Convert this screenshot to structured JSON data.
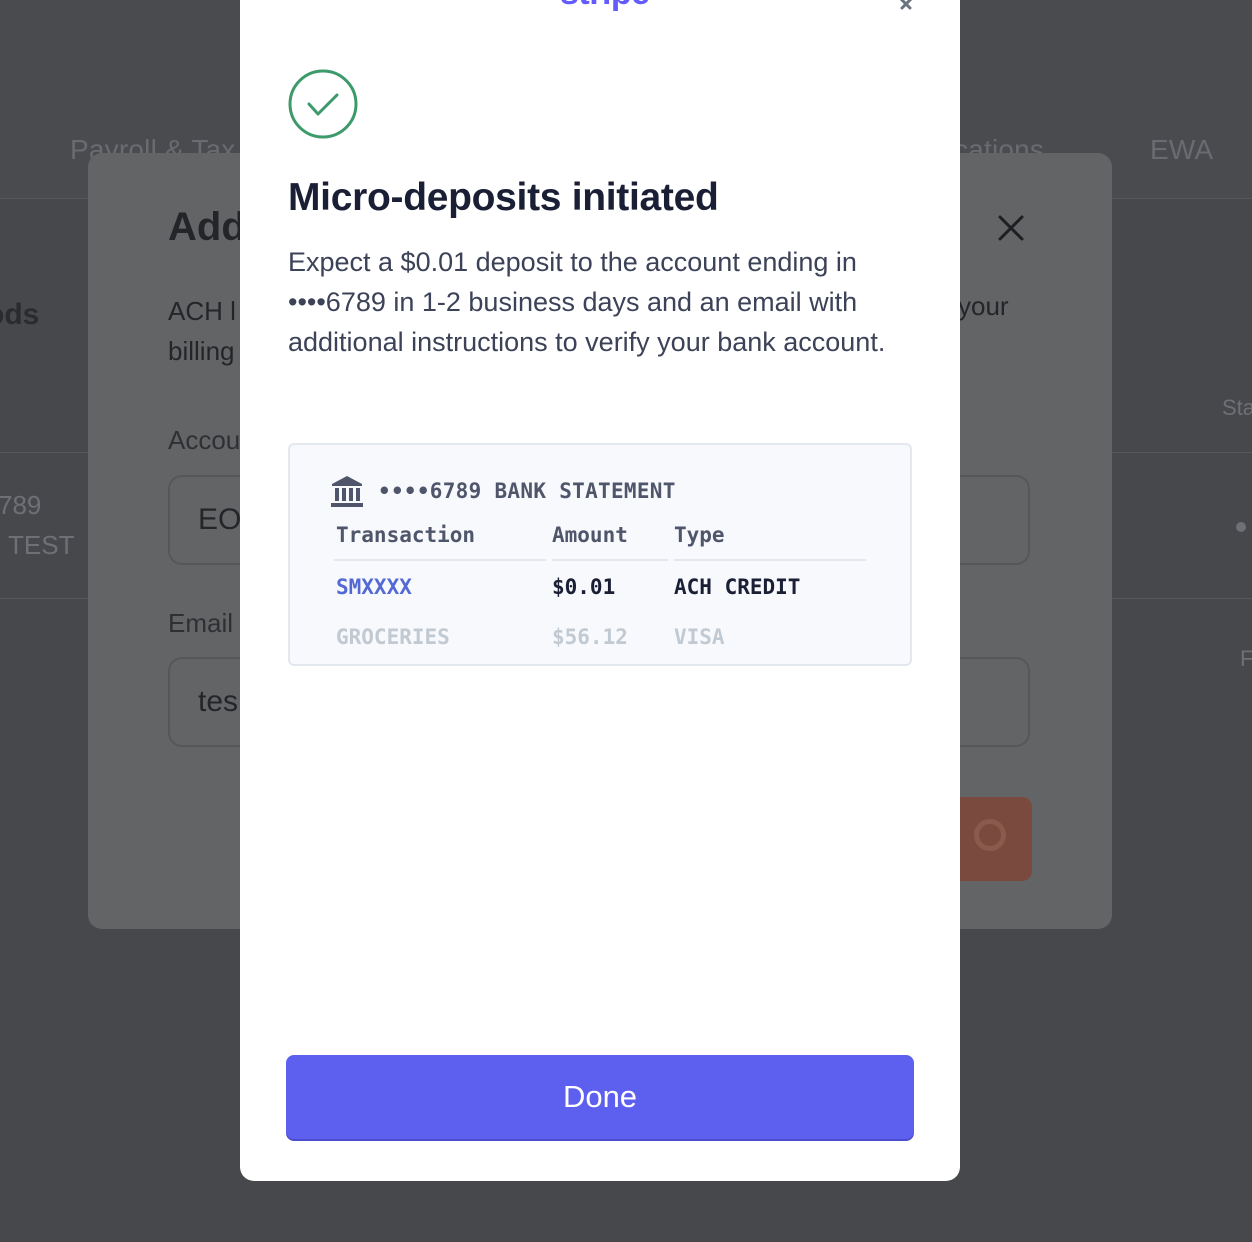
{
  "background": {
    "nav_tabs": [
      "Payroll & Tax",
      "cations",
      "EWA"
    ],
    "section_title": "ods",
    "row_text_1": "789",
    "row_text_2": "TEST",
    "col_header_right": "Sta",
    "col_header_right_2": "F"
  },
  "underlying_dialog": {
    "title": "Add",
    "description_line1": "ACH l",
    "description_line2": "billing",
    "description_right": "your",
    "account_label": "Accou",
    "account_value": "EO",
    "email_label": "Email",
    "email_value": "tes"
  },
  "modal": {
    "brand": "stripe",
    "title": "Micro-deposits initiated",
    "body": "Expect a $0.01 deposit to the account ending in ••••6789 in 1-2 business days and an email with additional instructions to verify your bank account.",
    "statement": {
      "header": "••••6789 BANK STATEMENT",
      "columns": [
        "Transaction",
        "Amount",
        "Type"
      ],
      "rows": [
        {
          "transaction": "SMXXXX",
          "amount": "$0.01",
          "type": "ACH CREDIT"
        },
        {
          "transaction": "GROCERIES",
          "amount": "$56.12",
          "type": "VISA"
        }
      ]
    },
    "done_label": "Done"
  },
  "colors": {
    "accent": "#635bff",
    "button": "#5d5fef",
    "success": "#3d9a6b",
    "title": "#1a1f36",
    "body_text": "#3c4257"
  },
  "icons": {
    "check": "check-circle-icon",
    "bank": "bank-icon",
    "close": "close-icon"
  }
}
